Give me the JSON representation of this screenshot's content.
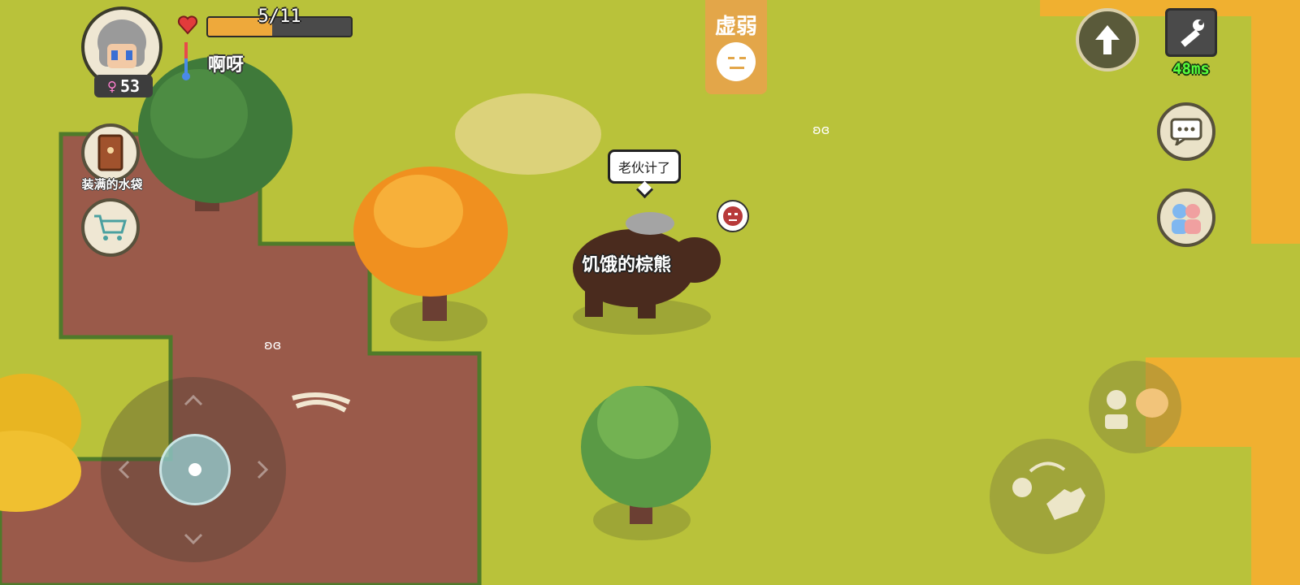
{
  "player": {
    "age": "53",
    "gender_symbol": "♀",
    "food_text": "5/11",
    "food_fraction": 0.45,
    "temperature_text": "啊呀"
  },
  "status": {
    "label": "虚弱",
    "face_icon": "neutral-face-icon"
  },
  "hud": {
    "ping": "48ms",
    "held_item_label": "装满的水袋"
  },
  "world": {
    "speech_bubble": "老伙计了",
    "animal_name": "饥饿的棕熊",
    "animal_mood_icon": "angry-face-icon"
  },
  "colors": {
    "grass": "#b9c23a",
    "dirt": "#9a5a4a",
    "autumn_grass": "#f0b030",
    "food_bar": "#eea93b",
    "ping_green": "#56ff3c"
  }
}
